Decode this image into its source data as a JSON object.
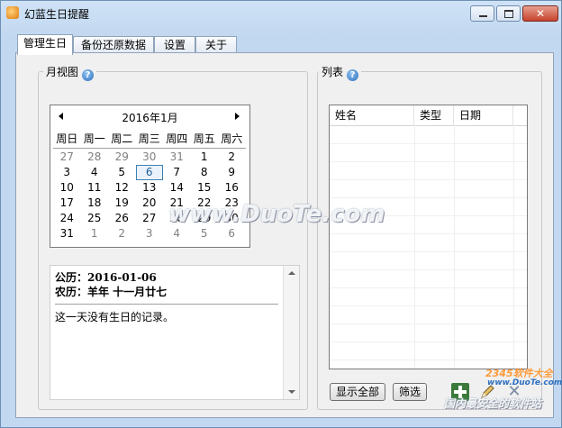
{
  "window": {
    "title": "幻蓝生日提醒",
    "close_glyph": "✕"
  },
  "tabs": [
    {
      "label": "管理生日",
      "active": true
    },
    {
      "label": "备份还原数据"
    },
    {
      "label": "设置"
    },
    {
      "label": "关于"
    }
  ],
  "month_view": {
    "label": "月视图",
    "help_glyph": "?",
    "title": "2016年1月",
    "weekdays": [
      "周日",
      "周一",
      "周二",
      "周三",
      "周四",
      "周五",
      "周六"
    ],
    "weeks": [
      [
        "27",
        "28",
        "29",
        "30",
        "31",
        "1",
        "2"
      ],
      [
        "3",
        "4",
        "5",
        "6",
        "7",
        "8",
        "9"
      ],
      [
        "10",
        "11",
        "12",
        "13",
        "14",
        "15",
        "16"
      ],
      [
        "17",
        "18",
        "19",
        "20",
        "21",
        "22",
        "23"
      ],
      [
        "24",
        "25",
        "26",
        "27",
        "28",
        "29",
        "30"
      ],
      [
        "31",
        "1",
        "2",
        "3",
        "4",
        "5",
        "6"
      ]
    ],
    "selected": "6"
  },
  "detail": {
    "solar": "公历：2016-01-06",
    "lunar": "农历：羊年  十一月廿七",
    "note": "这一天没有生日的记录。"
  },
  "list": {
    "label": "列表",
    "help_glyph": "?",
    "columns": [
      "姓名",
      "类型",
      "日期"
    ]
  },
  "buttons": {
    "show_all": "显示全部",
    "filter": "筛选"
  },
  "watermark": {
    "main": "www.DuoTe.com",
    "small": "2345软件大全",
    "small_url": "www.DuoTe.com",
    "slogan": "国内最安全的软件站"
  }
}
